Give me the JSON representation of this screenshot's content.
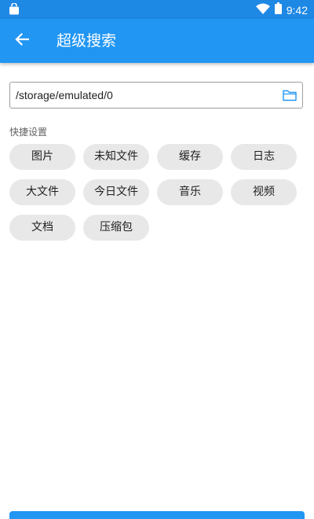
{
  "status_bar": {
    "time": "9:42",
    "icons": [
      "shopping-bag-icon",
      "wifi-icon",
      "battery-icon"
    ]
  },
  "app_bar": {
    "title": "超级搜索",
    "back_icon": "arrow-left-icon"
  },
  "path_field": {
    "value": "/storage/emulated/0",
    "icon": "folder-icon"
  },
  "quick_settings": {
    "label": "快捷设置",
    "chips": [
      {
        "label": "图片"
      },
      {
        "label": "未知文件"
      },
      {
        "label": "缓存"
      },
      {
        "label": "日志"
      },
      {
        "label": "大文件"
      },
      {
        "label": "今日文件"
      },
      {
        "label": "音乐"
      },
      {
        "label": "视频"
      },
      {
        "label": "文档"
      },
      {
        "label": "压缩包"
      }
    ]
  },
  "colors": {
    "status_bar": "#1E88E5",
    "app_bar": "#2196F3",
    "chip_background": "#E8E8E8",
    "accent": "#2196F3"
  }
}
